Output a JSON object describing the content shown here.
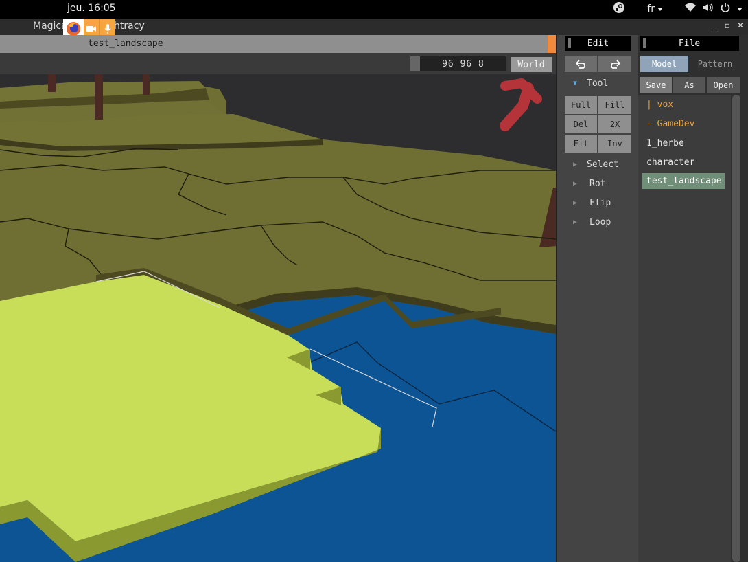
{
  "topbar": {
    "clock": "jeu. 16:05",
    "language": "fr",
    "icons": [
      "steam-icon",
      "wifi-icon",
      "volume-icon",
      "power-icon"
    ]
  },
  "window": {
    "title": "MagicaVoxel | Ephtracy",
    "controls": [
      "_",
      "▫",
      "✕"
    ]
  },
  "tab": {
    "file_name": "test_landscape"
  },
  "viewport": {
    "coordinates": "96 96 8",
    "world_label": "World"
  },
  "edit_panel": {
    "header": "Edit",
    "undo_icon": "undo-icon",
    "redo_icon": "redo-icon",
    "tool_label": "Tool",
    "tool_buttons": [
      [
        "Full",
        "Fill"
      ],
      [
        "Del",
        "2X"
      ],
      [
        "Fit",
        "Inv"
      ]
    ],
    "sections": [
      "Select",
      "Rot",
      "Flip",
      "Loop"
    ]
  },
  "file_panel": {
    "header": "File",
    "tabs": [
      "Model",
      "Pattern"
    ],
    "actions": [
      "Save",
      "As",
      "Open"
    ],
    "items": [
      {
        "label": "| vox",
        "type": "folder"
      },
      {
        "label": "- GameDev",
        "type": "folder"
      },
      {
        "label": "1_herbe",
        "type": "file"
      },
      {
        "label": "character",
        "type": "file"
      },
      {
        "label": "test_landscape",
        "type": "file",
        "selected": true
      }
    ]
  },
  "colors": {
    "grass": "#7a7a3c",
    "highlight": "#c8dd58",
    "water": "#0c5494",
    "accent_orange": "#f08a3c",
    "selected_file": "#6f8f78",
    "folder_text": "#f0a030",
    "annotation_arrow": "#b5343a"
  }
}
